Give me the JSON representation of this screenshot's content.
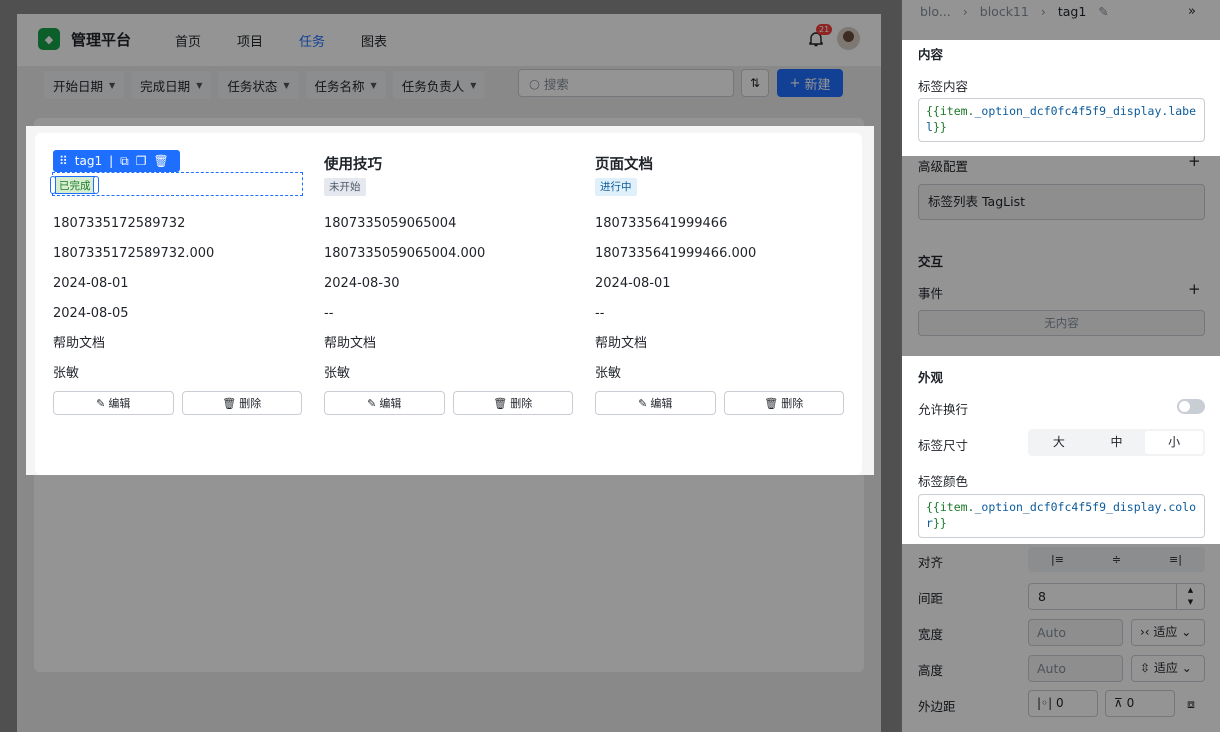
{
  "app": {
    "title": "管理平台",
    "nav": [
      "首页",
      "项目",
      "任务",
      "图表"
    ],
    "active_nav": "任务",
    "notification_count": "21"
  },
  "filters": [
    "开始日期",
    "完成日期",
    "任务状态",
    "任务名称",
    "任务负责人"
  ],
  "search": {
    "placeholder": "搜索"
  },
  "new_button": "新建",
  "selection_toolbar": {
    "label": "tag1"
  },
  "cards": [
    {
      "title": "",
      "tag": "已完成",
      "tag_color": "#1a7a29",
      "id": "1807335172589732",
      "amount": "1807335172589732.000",
      "start": "2024-08-01",
      "end": "2024-08-05",
      "project": "帮助文档",
      "owner": "张敏",
      "edit": "编辑",
      "delete": "删除"
    },
    {
      "title": "使用技巧",
      "tag": "未开始",
      "tag_color": "#4e5969",
      "id": "1807335059065004",
      "amount": "1807335059065004.000",
      "start": "2024-08-30",
      "end": "--",
      "project": "帮助文档",
      "owner": "张敏",
      "edit": "编辑",
      "delete": "删除"
    },
    {
      "title": "页面文档",
      "tag": "进行中",
      "tag_color": "#1e6fff",
      "id": "1807335641999466",
      "amount": "1807335641999466.000",
      "start": "2024-08-01",
      "end": "--",
      "project": "帮助文档",
      "owner": "张敏",
      "edit": "编辑",
      "delete": "删除"
    }
  ],
  "side": {
    "breadcrumb": [
      "blo...",
      "block11",
      "tag1"
    ],
    "content_section": "内容",
    "tag_content_label": "标签内容",
    "tag_content_expr_prefix": "{{item.",
    "tag_content_expr_body": "_option_dcf0fc4f5f9_display.label",
    "tag_content_expr_suffix": "}}",
    "advanced_section": "高级配置",
    "advanced_value": "标签列表 TagList",
    "interaction_section": "交互",
    "events_label": "事件",
    "events_empty": "无内容",
    "appearance_section": "外观",
    "wrap_label": "允许换行",
    "size_label": "标签尺寸",
    "size_options": [
      "大",
      "中",
      "小"
    ],
    "size_selected": "小",
    "color_label": "标签颜色",
    "color_expr_prefix": "{{item.",
    "color_expr_body": "_option_dcf0fc4f5f9_display.color",
    "color_expr_suffix": "}}",
    "align_label": "对齐",
    "gap_label": "间距",
    "gap_value": "8",
    "width_label": "宽度",
    "width_value": "Auto",
    "width_mode": "适应",
    "height_label": "高度",
    "height_value": "Auto",
    "height_mode": "适应",
    "margin_label": "外边距",
    "margin_h": "0",
    "margin_v": "0"
  }
}
